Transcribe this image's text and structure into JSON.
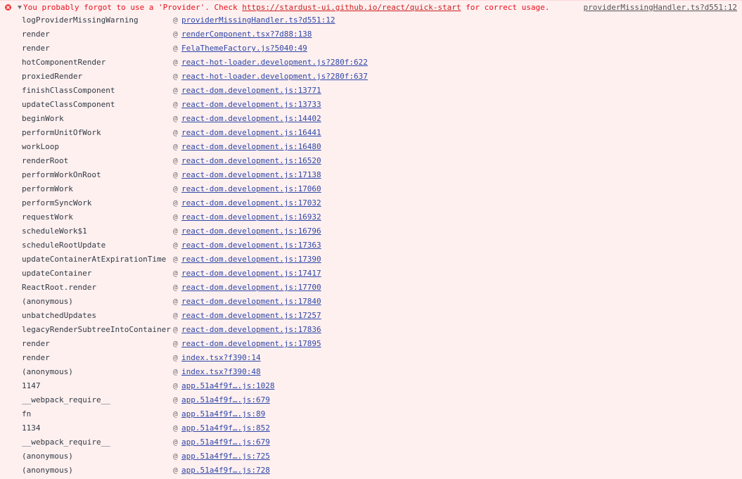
{
  "error": {
    "message_pre": "You probably forgot to use a 'Provider'. Check ",
    "message_link": "https://stardust-ui.github.io/react/quick-start",
    "message_post": " for correct usage.",
    "source": "providerMissingHandler.ts?d551:12"
  },
  "stack": [
    {
      "fn": "logProviderMissingWarning",
      "at": "@",
      "loc": "providerMissingHandler.ts?d551:12"
    },
    {
      "fn": "render",
      "at": "@",
      "loc": "renderComponent.tsx?7d88:138"
    },
    {
      "fn": "render",
      "at": "@",
      "loc": "FelaThemeFactory.js?5040:49"
    },
    {
      "fn": "hotComponentRender",
      "at": "@",
      "loc": "react-hot-loader.development.js?280f:622"
    },
    {
      "fn": "proxiedRender",
      "at": "@",
      "loc": "react-hot-loader.development.js?280f:637"
    },
    {
      "fn": "finishClassComponent",
      "at": "@",
      "loc": "react-dom.development.js:13771"
    },
    {
      "fn": "updateClassComponent",
      "at": "@",
      "loc": "react-dom.development.js:13733"
    },
    {
      "fn": "beginWork",
      "at": "@",
      "loc": "react-dom.development.js:14402"
    },
    {
      "fn": "performUnitOfWork",
      "at": "@",
      "loc": "react-dom.development.js:16441"
    },
    {
      "fn": "workLoop",
      "at": "@",
      "loc": "react-dom.development.js:16480"
    },
    {
      "fn": "renderRoot",
      "at": "@",
      "loc": "react-dom.development.js:16520"
    },
    {
      "fn": "performWorkOnRoot",
      "at": "@",
      "loc": "react-dom.development.js:17138"
    },
    {
      "fn": "performWork",
      "at": "@",
      "loc": "react-dom.development.js:17060"
    },
    {
      "fn": "performSyncWork",
      "at": "@",
      "loc": "react-dom.development.js:17032"
    },
    {
      "fn": "requestWork",
      "at": "@",
      "loc": "react-dom.development.js:16932"
    },
    {
      "fn": "scheduleWork$1",
      "at": "@",
      "loc": "react-dom.development.js:16796"
    },
    {
      "fn": "scheduleRootUpdate",
      "at": "@",
      "loc": "react-dom.development.js:17363"
    },
    {
      "fn": "updateContainerAtExpirationTime",
      "at": "@",
      "loc": "react-dom.development.js:17390"
    },
    {
      "fn": "updateContainer",
      "at": "@",
      "loc": "react-dom.development.js:17417"
    },
    {
      "fn": "ReactRoot.render",
      "at": "@",
      "loc": "react-dom.development.js:17700"
    },
    {
      "fn": "(anonymous)",
      "at": "@",
      "loc": "react-dom.development.js:17840"
    },
    {
      "fn": "unbatchedUpdates",
      "at": "@",
      "loc": "react-dom.development.js:17257"
    },
    {
      "fn": "legacyRenderSubtreeIntoContainer",
      "at": "@",
      "loc": "react-dom.development.js:17836"
    },
    {
      "fn": "render",
      "at": "@",
      "loc": "react-dom.development.js:17895"
    },
    {
      "fn": "render",
      "at": "@",
      "loc": "index.tsx?f390:14"
    },
    {
      "fn": "(anonymous)",
      "at": "@",
      "loc": "index.tsx?f390:48"
    },
    {
      "fn": "1147",
      "at": "@",
      "loc": "app.51a4f9f….js:1028"
    },
    {
      "fn": "__webpack_require__",
      "at": "@",
      "loc": "app.51a4f9f….js:679"
    },
    {
      "fn": "fn",
      "at": "@",
      "loc": "app.51a4f9f….js:89"
    },
    {
      "fn": "1134",
      "at": "@",
      "loc": "app.51a4f9f….js:852"
    },
    {
      "fn": "__webpack_require__",
      "at": "@",
      "loc": "app.51a4f9f….js:679"
    },
    {
      "fn": "(anonymous)",
      "at": "@",
      "loc": "app.51a4f9f….js:725"
    },
    {
      "fn": "(anonymous)",
      "at": "@",
      "loc": "app.51a4f9f….js:728"
    }
  ]
}
